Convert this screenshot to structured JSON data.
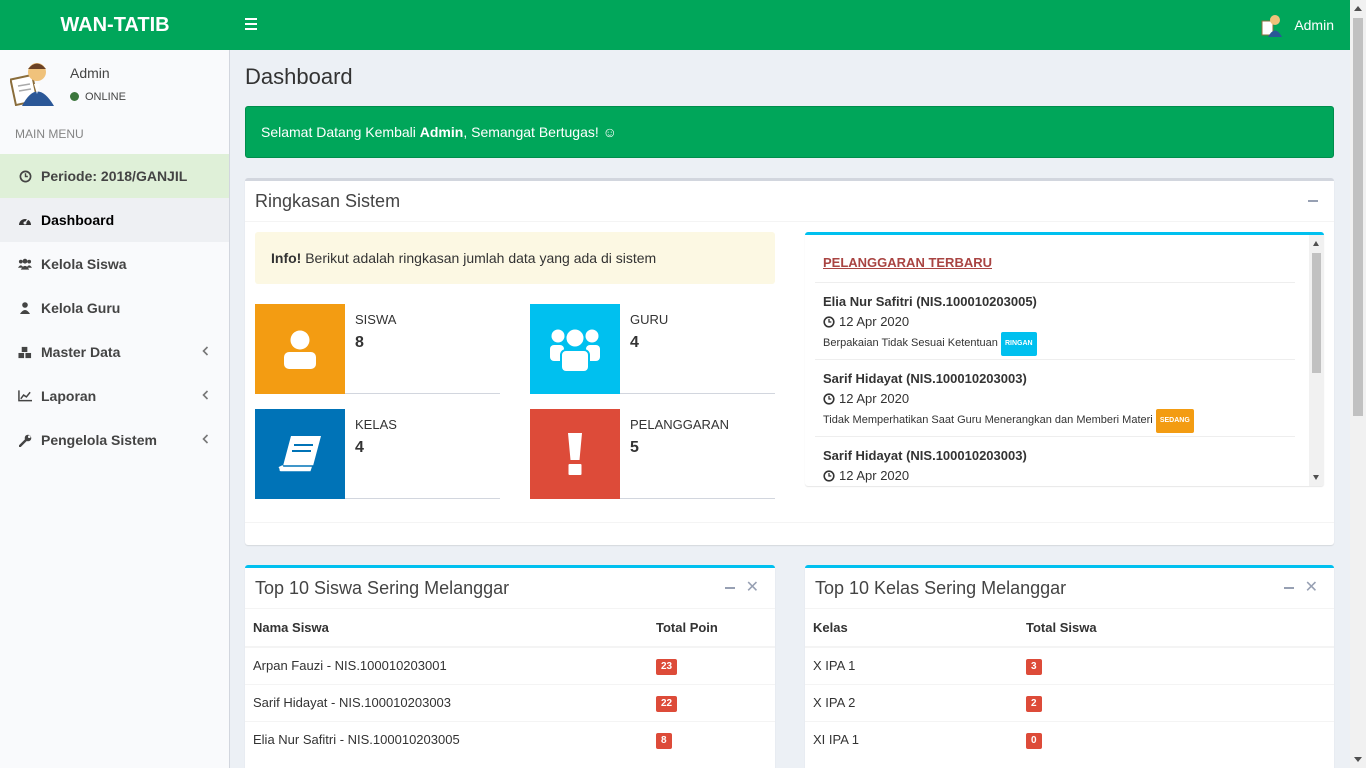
{
  "header": {
    "logo": "WAN-TATIB",
    "user_name": "Admin"
  },
  "sidebar": {
    "user_name": "Admin",
    "status": "ONLINE",
    "menu_header": "MAIN MENU",
    "items": [
      {
        "label": "Periode: 2018/GANJIL",
        "icon": "clock-icon"
      },
      {
        "label": "Dashboard",
        "icon": "dashboard-icon"
      },
      {
        "label": "Kelola Siswa",
        "icon": "users-icon"
      },
      {
        "label": "Kelola Guru",
        "icon": "user-icon"
      },
      {
        "label": "Master Data",
        "icon": "cubes-icon"
      },
      {
        "label": "Laporan",
        "icon": "line-chart-icon"
      },
      {
        "label": "Pengelola Sistem",
        "icon": "wrench-icon"
      }
    ]
  },
  "page": {
    "title": "Dashboard"
  },
  "welcome": {
    "prefix": "Selamat Datang Kembali ",
    "name": "Admin",
    "suffix": ", Semangat Bertugas! ☺"
  },
  "summary": {
    "title": "Ringkasan Sistem",
    "info_bold": "Info!",
    "info_text": " Berikut adalah ringkasan jumlah data yang ada di sistem",
    "stats": [
      {
        "label": "SISWA",
        "value": "8",
        "color": "#f39c12",
        "icon": "user-icon"
      },
      {
        "label": "GURU",
        "value": "4",
        "color": "#00c0ef",
        "icon": "users-icon"
      },
      {
        "label": "KELAS",
        "value": "4",
        "color": "#0073b7",
        "icon": "book-icon"
      },
      {
        "label": "PELANGGARAN",
        "value": "5",
        "color": "#dd4b39",
        "icon": "exclamation-icon"
      }
    ]
  },
  "violations": {
    "title": "PELANGGARAN TERBARU",
    "items": [
      {
        "name": "Elia Nur Safitri (NIS.100010203005)",
        "date": "12 Apr 2020",
        "desc": "Berpakaian Tidak Sesuai Ketentuan",
        "badge": "RINGAN",
        "badge_color": "#00c0ef"
      },
      {
        "name": "Sarif Hidayat (NIS.100010203003)",
        "date": "12 Apr 2020",
        "desc": "Tidak Memperhatikan Saat Guru Menerangkan dan Memberi Materi",
        "badge": "SEDANG",
        "badge_color": "#f39c12"
      },
      {
        "name": "Sarif Hidayat (NIS.100010203003)",
        "date": "12 Apr 2020"
      }
    ]
  },
  "top_students": {
    "title": "Top 10 Siswa Sering Melanggar",
    "headers": [
      "Nama Siswa",
      "Total Poin"
    ],
    "rows": [
      {
        "name": "Arpan Fauzi - NIS.100010203001",
        "value": "23"
      },
      {
        "name": "Sarif Hidayat - NIS.100010203003",
        "value": "22"
      },
      {
        "name": "Elia Nur Safitri - NIS.100010203005",
        "value": "8"
      }
    ]
  },
  "top_classes": {
    "title": "Top 10 Kelas Sering Melanggar",
    "headers": [
      "Kelas",
      "Total Siswa"
    ],
    "rows": [
      {
        "name": "X IPA 1",
        "value": "3"
      },
      {
        "name": "X IPA 2",
        "value": "2"
      },
      {
        "name": "XI IPA 1",
        "value": "0"
      }
    ]
  }
}
